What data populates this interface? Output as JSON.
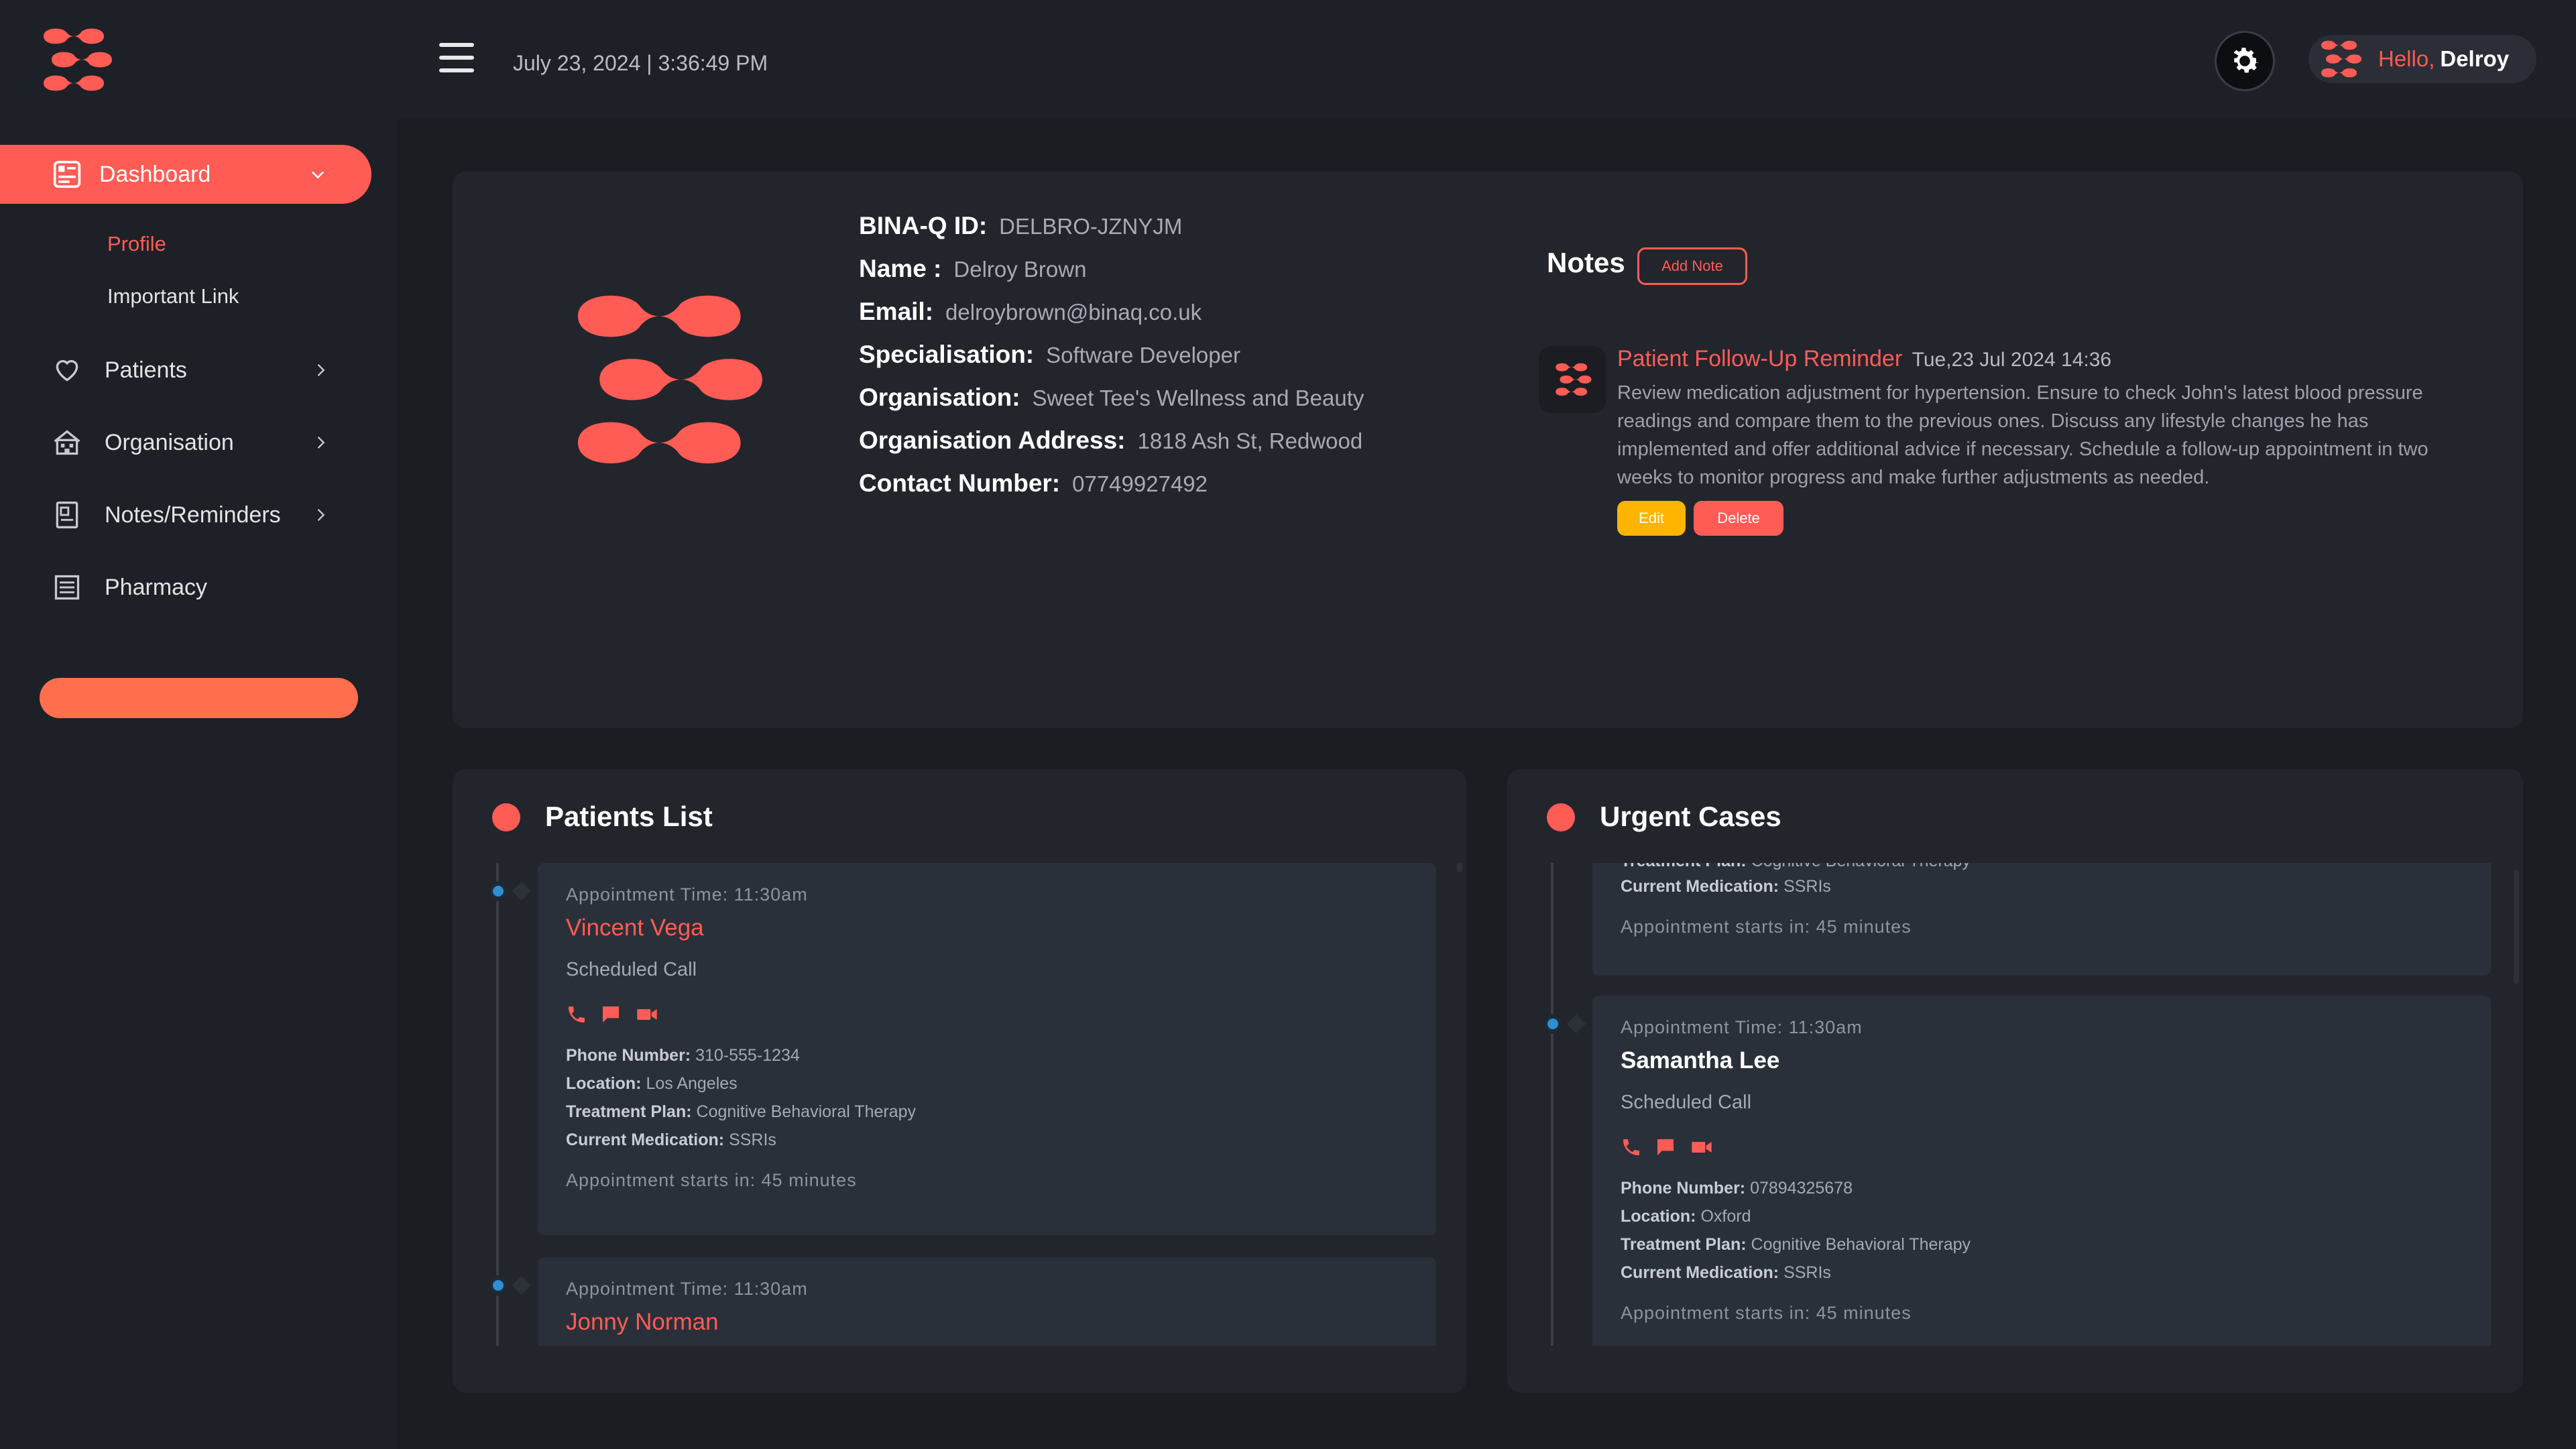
{
  "header": {
    "datetime": "July 23, 2024 | 3:36:49 PM",
    "greeting": "Hello,",
    "username": "Delroy"
  },
  "sidebar": {
    "active": {
      "label": "Dashboard"
    },
    "subitems": [
      {
        "label": "Profile",
        "active": true
      },
      {
        "label": "Important Link",
        "active": false
      }
    ],
    "items": [
      {
        "label": "Patients",
        "icon": "heart-icon"
      },
      {
        "label": "Organisation",
        "icon": "building-icon"
      },
      {
        "label": "Notes/Reminders",
        "icon": "notebook-icon"
      },
      {
        "label": "Pharmacy",
        "icon": "list-icon"
      }
    ]
  },
  "profile": {
    "fields": [
      {
        "key": "BINA-Q ID:",
        "value": "DELBRO-JZNYJM"
      },
      {
        "key": "Name :",
        "value": "Delroy Brown"
      },
      {
        "key": "Email:",
        "value": "delroybrown@binaq.co.uk"
      },
      {
        "key": "Specialisation:",
        "value": "Software Developer"
      },
      {
        "key": "Organisation:",
        "value": "Sweet Tee's Wellness and Beauty"
      },
      {
        "key": "Organisation Address:",
        "value": "1818 Ash St, Redwood"
      },
      {
        "key": "Contact Number:",
        "value": "07749927492"
      }
    ]
  },
  "notes": {
    "title": "Notes",
    "add_label": "Add Note",
    "items": [
      {
        "title": "Patient Follow-Up Reminder",
        "time": "Tue,23 Jul 2024 14:36",
        "text": "Review medication adjustment for hypertension. Ensure to check John's latest blood pressure readings and compare them to the previous ones. Discuss any lifestyle changes he has implemented and offer additional advice if necessary. Schedule a follow-up appointment in two weeks to monitor progress and make further adjustments as needed.",
        "edit_label": "Edit",
        "delete_label": "Delete"
      }
    ]
  },
  "patients_list": {
    "title": "Patients List",
    "appointments": [
      {
        "time": "Appointment Time: 11:30am",
        "name": "Vincent Vega",
        "type": "Scheduled Call",
        "phone_label": "Phone Number:",
        "phone": "310-555-1234",
        "location_label": "Location:",
        "location": "Los Angeles",
        "plan_label": "Treatment Plan:",
        "plan": "Cognitive Behavioral Therapy",
        "med_label": "Current Medication:",
        "med": "SSRIs",
        "starts": "Appointment starts in: 45 minutes"
      },
      {
        "time": "Appointment Time: 11:30am",
        "name": "Jonny Norman"
      }
    ]
  },
  "urgent_cases": {
    "title": "Urgent Cases",
    "partial": {
      "plan_label": "Treatment Plan:",
      "plan": "Cognitive Behavioral Therapy",
      "med_label": "Current Medication:",
      "med": "SSRIs",
      "starts": "Appointment starts in: 45 minutes"
    },
    "appointments": [
      {
        "time": "Appointment Time: 11:30am",
        "name": "Samantha Lee",
        "type": "Scheduled Call",
        "phone_label": "Phone Number:",
        "phone": "07894325678",
        "location_label": "Location:",
        "location": "Oxford",
        "plan_label": "Treatment Plan:",
        "plan": "Cognitive Behavioral Therapy",
        "med_label": "Current Medication:",
        "med": "SSRIs",
        "starts": "Appointment starts in: 45 minutes"
      }
    ]
  },
  "colors": {
    "accent": "#ff5c55",
    "warning": "#ffb400",
    "timeline_dot": "#2f8fd0"
  }
}
